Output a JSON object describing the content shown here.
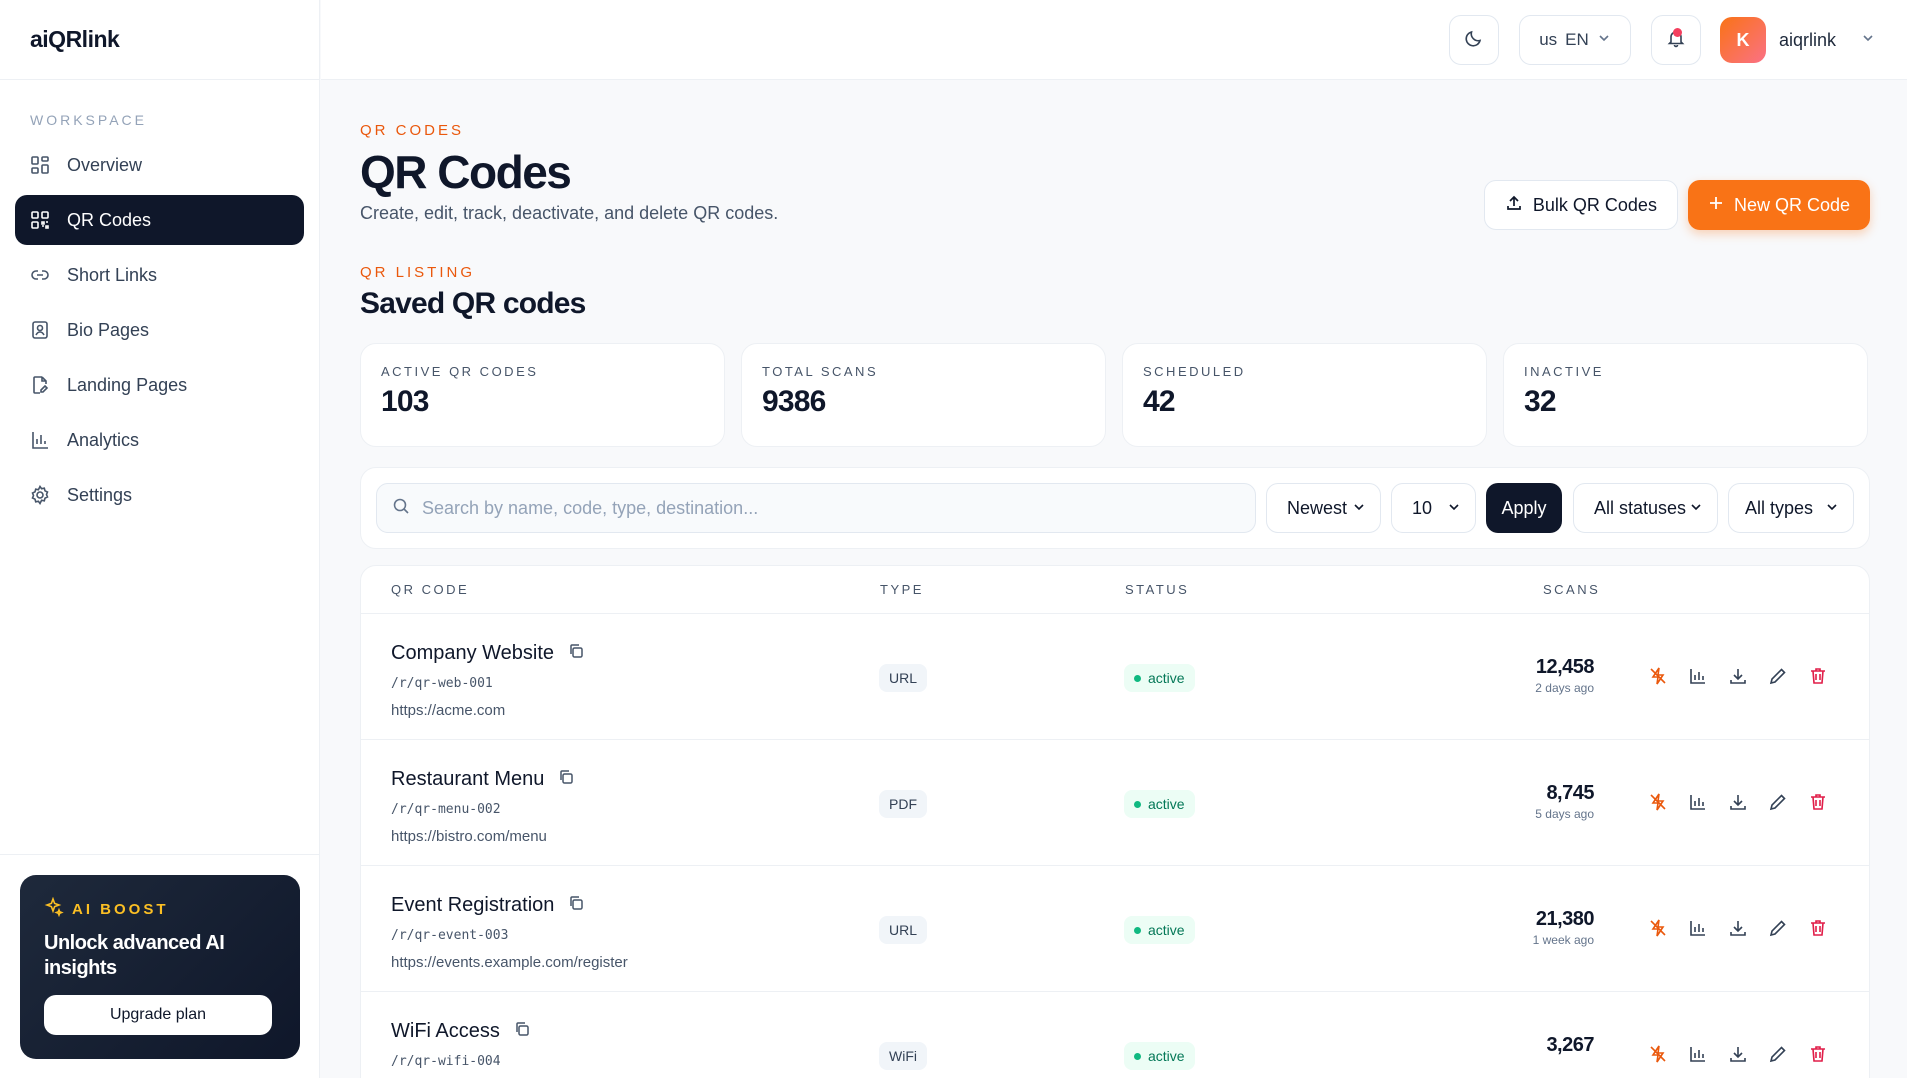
{
  "app": {
    "brand": "aiQRlink"
  },
  "sidebar": {
    "section_label": "WORKSPACE",
    "items": [
      {
        "label": "Overview",
        "icon": "grid-icon"
      },
      {
        "label": "QR Codes",
        "icon": "qr-icon",
        "active": true
      },
      {
        "label": "Short Links",
        "icon": "link-icon"
      },
      {
        "label": "Bio Pages",
        "icon": "user-card-icon"
      },
      {
        "label": "Landing Pages",
        "icon": "page-edit-icon"
      },
      {
        "label": "Analytics",
        "icon": "bar-chart-icon"
      },
      {
        "label": "Settings",
        "icon": "gear-icon"
      }
    ],
    "boost": {
      "tag": "AI BOOST",
      "title": "Unlock advanced AI insights",
      "button": "Upgrade plan"
    }
  },
  "header": {
    "lang_flag": "us",
    "lang_code": "EN",
    "avatar_letter": "K",
    "username": "aiqrlink"
  },
  "page": {
    "eyebrow": "QR CODES",
    "title": "QR Codes",
    "subtitle": "Create, edit, track, deactivate, and delete QR codes.",
    "bulk_button": "Bulk QR Codes",
    "new_button": "New QR Code",
    "listing_eyebrow": "QR LISTING",
    "listing_title": "Saved QR codes"
  },
  "stats": [
    {
      "label": "ACTIVE QR CODES",
      "value": "103"
    },
    {
      "label": "TOTAL SCANS",
      "value": "9386"
    },
    {
      "label": "SCHEDULED",
      "value": "42"
    },
    {
      "label": "INACTIVE",
      "value": "32"
    }
  ],
  "filters": {
    "search_placeholder": "Search by name, code, type, destination...",
    "sort": "Newest",
    "per_page": "10",
    "apply": "Apply",
    "status": "All statuses",
    "type": "All types"
  },
  "table": {
    "headers": {
      "qr_code": "QR CODE",
      "type": "TYPE",
      "status": "STATUS",
      "scans": "SCANS"
    },
    "rows": [
      {
        "name": "Company Website",
        "code": "/r/qr-web-001",
        "dest": "https://acme.com",
        "type": "URL",
        "status": "active",
        "scans": "12,458",
        "ago": "2 days ago"
      },
      {
        "name": "Restaurant Menu",
        "code": "/r/qr-menu-002",
        "dest": "https://bistro.com/menu",
        "type": "PDF",
        "status": "active",
        "scans": "8,745",
        "ago": "5 days ago"
      },
      {
        "name": "Event Registration",
        "code": "/r/qr-event-003",
        "dest": "https://events.example.com/register",
        "type": "URL",
        "status": "active",
        "scans": "21,380",
        "ago": "1 week ago"
      },
      {
        "name": "WiFi Access",
        "code": "/r/qr-wifi-004",
        "dest": "",
        "type": "WiFi",
        "status": "active",
        "scans": "3,267",
        "ago": ""
      }
    ]
  },
  "colors": {
    "accent": "#f97316",
    "dark": "#0f172a",
    "success": "#10b981",
    "danger": "#e11d48"
  }
}
